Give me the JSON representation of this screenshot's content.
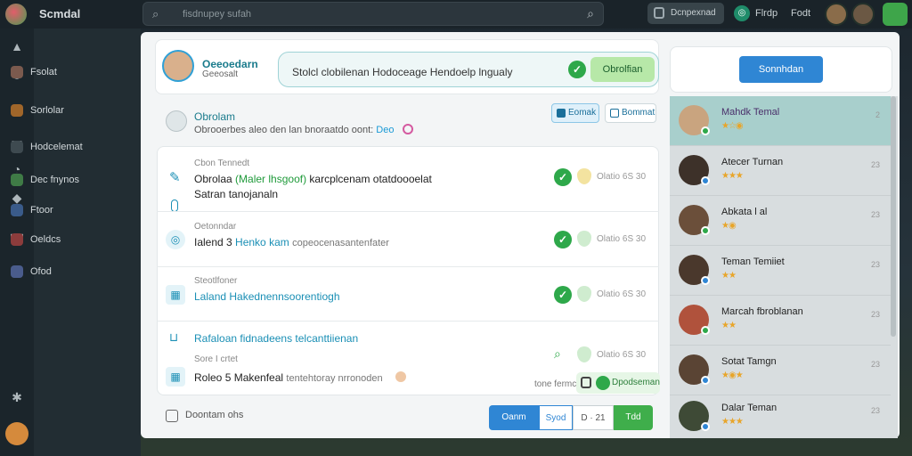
{
  "app": {
    "name": "Scmdal"
  },
  "search": {
    "placeholder": "fisdnupey sufah"
  },
  "topbar": {
    "pill_label": "Dcnpexnad",
    "label1": "Flrdp",
    "label2": "Fodt"
  },
  "sidebar": {
    "items": [
      {
        "label": "Fsolat"
      },
      {
        "label": "Sorlolar"
      },
      {
        "label": "Hodcelemat"
      },
      {
        "label": "Dec fnynos"
      },
      {
        "label": "Ftoor"
      },
      {
        "label": "Oeldcs"
      },
      {
        "label": "Ofod"
      }
    ]
  },
  "header": {
    "name": "Oeeoedarn",
    "sub": "Geeosalt",
    "compose_text": "Stolcl clobilenan Hodoceage Hendoelp lngualy",
    "compose_button": "Obrolfian"
  },
  "info": {
    "title": "Obrolam",
    "sub": "Obrooerbes aleo den lan bnoraatdo oont:",
    "link": "Deo",
    "chip1": "Eomak",
    "chip2": "Bommat"
  },
  "feed": {
    "rows": [
      {
        "caption": "Cbon Tennedt",
        "main_plain": "Obrolaa",
        "main_green": "(Maler lhsgoof)",
        "main_rest": "karcplcenam otatdoooelat",
        "main_line2": "Satran tanojanaln",
        "id": "Olatio 6S 30"
      },
      {
        "caption": "Oetonndar",
        "main_plain": "Ialend 3",
        "main_teal": "Henko kam",
        "main_muted": "copeocenasantenfater",
        "id": "Olatio 6S 30"
      },
      {
        "caption": "Steotlfoner",
        "main_teal": "Laland",
        "main_rest": "Hakednennsoorentiogh",
        "id": "Olatio 6S 30"
      },
      {
        "caption": "Sore I crtet",
        "title_teal": "Rafaloan fidnadeens telcanttiienan",
        "main_plain": "Roleo 5 Makenfeal",
        "main_muted": "tentehtoray nrronoden",
        "id": "Olatio 6S 30"
      }
    ],
    "mini_label": "tone fermct",
    "mini_pill": "Dpodseman"
  },
  "footer": {
    "left_button": "Doontam ohs",
    "seg1": "Oanm",
    "seg2": "Syod",
    "seg3": "D  · 21",
    "seg4": "Tdd"
  },
  "right_panel": {
    "button": "Sonnhdan",
    "contacts": [
      {
        "name": "Mahdk Temal",
        "stars": "★☆◉",
        "time": "2",
        "status": "#2ea84a"
      },
      {
        "name": "Atecer Turnan",
        "stars": "★★★",
        "time": "23",
        "status": "#2f86d4"
      },
      {
        "name": "Abkata l al",
        "stars": "★◉",
        "time": "23",
        "status": "#2ea84a"
      },
      {
        "name": "Teman Temiiet",
        "stars": "★★",
        "time": "23",
        "status": "#2f86d4"
      },
      {
        "name": "Marcah fbroblanan",
        "stars": "★★",
        "time": "23",
        "status": "#2ea84a"
      },
      {
        "name": "Sotat Tamgn",
        "stars": "★◉★",
        "time": "23",
        "status": "#2f86d4"
      },
      {
        "name": "Dalar Teman",
        "stars": "★★★",
        "time": "23",
        "status": "#2f86d4"
      }
    ]
  },
  "colors": {
    "accent": "#2f86d4",
    "success": "#2ea84a",
    "teal": "#1a8fb5"
  }
}
